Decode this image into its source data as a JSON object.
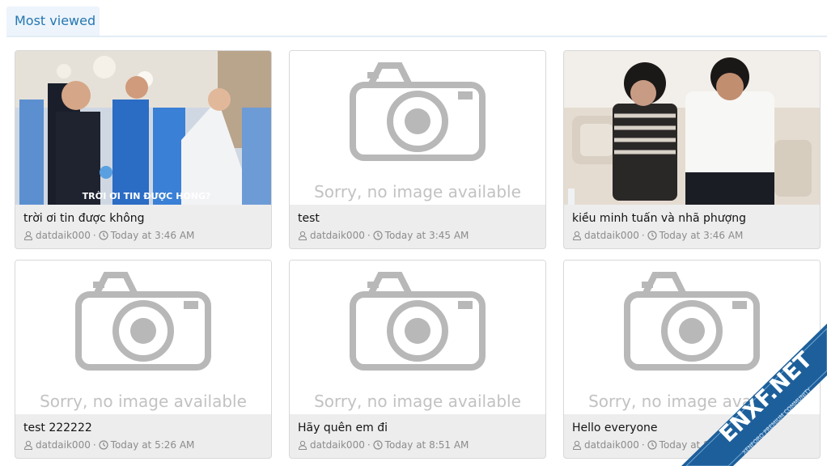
{
  "tabs": {
    "active_label": "Most viewed"
  },
  "placeholder_text": "Sorry, no image available",
  "cards": [
    {
      "title": "trời ơi tin được không",
      "author": "datdaik000",
      "separator": "·",
      "time": "Today at 3:46 AM",
      "thumb": "photo",
      "caption": "TRỜI ƠI TIN ĐƯỢC HONG?"
    },
    {
      "title": "test",
      "author": "datdaik000",
      "separator": "·",
      "time": "Today at 3:45 AM",
      "thumb": "placeholder"
    },
    {
      "title": "kiều minh tuấn và nhã phượng",
      "author": "datdaik000",
      "separator": "·",
      "time": "Today at 3:46 AM",
      "thumb": "photo"
    },
    {
      "title": "test 222222",
      "author": "datdaik000",
      "separator": "·",
      "time": "Today at 5:26 AM",
      "thumb": "placeholder"
    },
    {
      "title": "Hãy quên em đi",
      "author": "datdaik000",
      "separator": "·",
      "time": "Today at 8:51 AM",
      "thumb": "placeholder"
    },
    {
      "title": "Hello everyone",
      "author": "datdaik000",
      "separator": "·",
      "time": "Today at 8:51 AM",
      "thumb": "placeholder"
    }
  ],
  "watermark": {
    "brand": "ENXF.NET",
    "tagline": "XENFORO PREMIUM COMMUNITY"
  },
  "colors": {
    "tab_text": "#2577b1",
    "tab_bg": "#edf4fb",
    "card_footer": "#ededed",
    "meta_text": "#8c8c8c",
    "watermark_blue": "#1d5f9a"
  }
}
